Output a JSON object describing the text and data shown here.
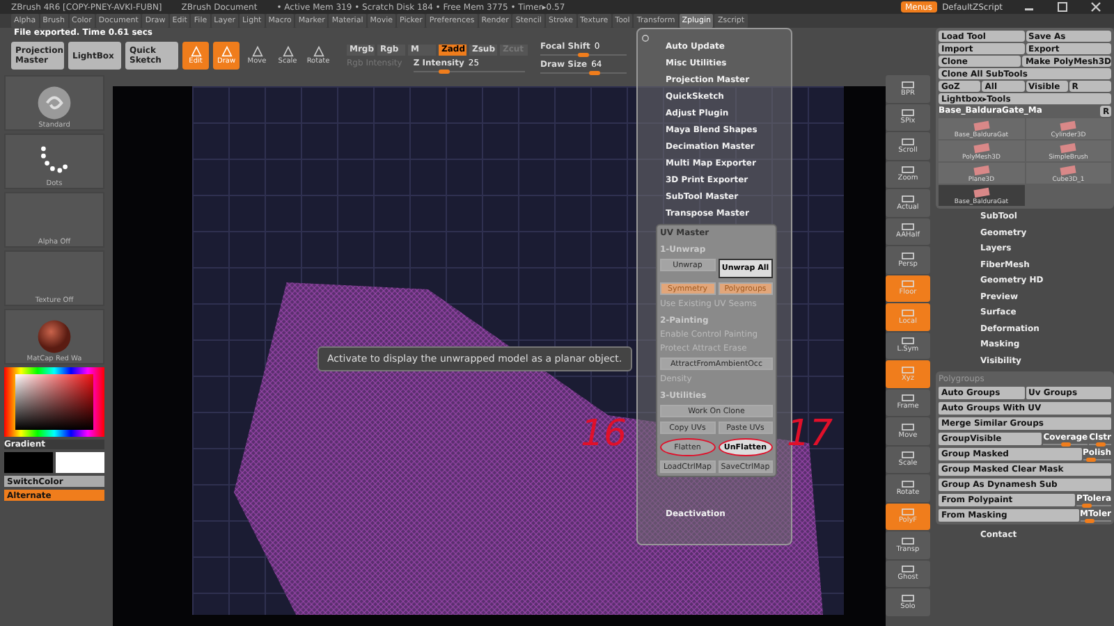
{
  "title_bar": {
    "app": "ZBrush 4R6 [COPY-PNEY-AVKI-FUBN]",
    "document": "ZBrush Document",
    "stats": "• Active Mem 319 • Scratch Disk 184 • Free Mem 3775 • Timer▸0.57",
    "menus_button": "Menus",
    "script": "DefaultZScript"
  },
  "menu_bar": [
    {
      "label": "Alpha",
      "selected": false
    },
    {
      "label": "Brush",
      "selected": false
    },
    {
      "label": "Color",
      "selected": false
    },
    {
      "label": "Document",
      "selected": false
    },
    {
      "label": "Draw",
      "selected": false
    },
    {
      "label": "Edit",
      "selected": false
    },
    {
      "label": "File",
      "selected": false
    },
    {
      "label": "Layer",
      "selected": false
    },
    {
      "label": "Light",
      "selected": false
    },
    {
      "label": "Macro",
      "selected": false
    },
    {
      "label": "Marker",
      "selected": false
    },
    {
      "label": "Material",
      "selected": false
    },
    {
      "label": "Movie",
      "selected": false
    },
    {
      "label": "Picker",
      "selected": false
    },
    {
      "label": "Preferences",
      "selected": false
    },
    {
      "label": "Render",
      "selected": false
    },
    {
      "label": "Stencil",
      "selected": false
    },
    {
      "label": "Stroke",
      "selected": false
    },
    {
      "label": "Texture",
      "selected": false
    },
    {
      "label": "Tool",
      "selected": false
    },
    {
      "label": "Transform",
      "selected": false
    },
    {
      "label": "Zplugin",
      "selected": true
    },
    {
      "label": "Zscript",
      "selected": false
    }
  ],
  "status": "File exported. Time 0.61 secs",
  "toolbar": {
    "buttons": [
      {
        "label": "Projection Master",
        "kind": "large",
        "on": false
      },
      {
        "label": "LightBox",
        "kind": "large",
        "on": false
      },
      {
        "label": "Quick Sketch",
        "kind": "large",
        "on": false
      },
      {
        "label": "Edit",
        "kind": "mode",
        "on": true
      },
      {
        "label": "Draw",
        "kind": "mode",
        "on": true
      },
      {
        "label": "Move",
        "kind": "mode",
        "on": false
      },
      {
        "label": "Scale",
        "kind": "mode",
        "on": false
      },
      {
        "label": "Rotate",
        "kind": "mode",
        "on": false
      }
    ],
    "toggles": [
      {
        "label": "Mrgb",
        "on": false,
        "disabled": false
      },
      {
        "label": "Rgb",
        "on": false,
        "disabled": false
      },
      {
        "label": "M",
        "on": false,
        "disabled": false
      },
      {
        "label": "Zadd",
        "on": true,
        "disabled": false
      },
      {
        "label": "Zsub",
        "on": false,
        "disabled": false
      },
      {
        "label": "Zcut",
        "on": false,
        "disabled": true
      }
    ],
    "rgb_intensity": "Rgb Intensity",
    "sliders": [
      {
        "label": "Focal Shift",
        "reading": "0",
        "level": 0.5
      },
      {
        "label": "Z Intensity",
        "reading": "25",
        "level": 0.25
      },
      {
        "label": "Draw Size",
        "reading": "64",
        "level": 0.64
      }
    ]
  },
  "shelf": {
    "items": [
      {
        "label": "Standard",
        "kind": "brush"
      },
      {
        "label": "Dots",
        "kind": "stroke"
      },
      {
        "label": "Alpha Off",
        "kind": "empty"
      },
      {
        "label": "Texture Off",
        "kind": "empty"
      },
      {
        "label": "MatCap Red Wa",
        "kind": "material"
      }
    ],
    "gradient": "Gradient",
    "switch_color": "SwitchColor",
    "alternate": {
      "label": "Alternate",
      "on": true
    }
  },
  "canvas": {
    "tooltip": "Activate to display the unwrapped model as a planar object.",
    "annotations": [
      "16",
      "17"
    ]
  },
  "zplugin_menu": {
    "items": [
      "Auto Update",
      "Misc Utilities",
      "Projection Master",
      "QuickSketch",
      "Adjust Plugin",
      "Maya Blend Shapes",
      "Decimation Master",
      "Multi Map Exporter",
      "3D Print Exporter",
      "SubTool Master",
      "Transpose Master"
    ],
    "uv_master": {
      "title": "UV Master",
      "rows": [
        {
          "kind": "heading",
          "label": "1-Unwrap"
        },
        {
          "kind": "buttons",
          "items": [
            {
              "label": "Unwrap",
              "kind": "dim",
              "circled": false
            },
            {
              "label": "Unwrap All",
              "kind": "active",
              "circled": false
            }
          ]
        },
        {
          "kind": "buttons",
          "items": [
            {
              "label": "Symmetry",
              "kind": "toggle_on",
              "circled": false
            },
            {
              "label": "Polygroups",
              "kind": "toggle_on",
              "circled": false
            }
          ]
        },
        {
          "kind": "text",
          "label": "Use Existing UV Seams"
        },
        {
          "kind": "heading",
          "label": "2-Painting"
        },
        {
          "kind": "text",
          "label": "Enable Control Painting"
        },
        {
          "kind": "text",
          "label": "Protect Attract Erase"
        },
        {
          "kind": "buttons",
          "items": [
            {
              "label": "AttractFromAmbientOcc",
              "kind": "dim",
              "circled": false
            }
          ]
        },
        {
          "kind": "text",
          "label": "Density"
        },
        {
          "kind": "heading",
          "label": "3-Utilities"
        },
        {
          "kind": "buttons",
          "items": [
            {
              "label": "Work On Clone",
              "kind": "dim",
              "circled": false
            }
          ]
        },
        {
          "kind": "buttons",
          "items": [
            {
              "label": "Copy UVs",
              "kind": "dim",
              "circled": false
            },
            {
              "label": "Paste UVs",
              "kind": "dim",
              "circled": false
            }
          ]
        },
        {
          "kind": "buttons",
          "items": [
            {
              "label": "Flatten",
              "kind": "dim",
              "circled": true
            },
            {
              "label": "UnFlatten",
              "kind": "active",
              "circled": true
            }
          ]
        },
        {
          "kind": "buttons",
          "items": [
            {
              "label": "LoadCtrlMap",
              "kind": "dim",
              "circled": false
            },
            {
              "label": "SaveCtrlMap",
              "kind": "dim",
              "circled": false
            }
          ]
        }
      ]
    },
    "deactivation": "Deactivation"
  },
  "view_strip": [
    {
      "label": "BPR",
      "on": false
    },
    {
      "label": "SPix",
      "on": false
    },
    {
      "label": "Scroll",
      "on": false
    },
    {
      "label": "Zoom",
      "on": false
    },
    {
      "label": "Actual",
      "on": false
    },
    {
      "label": "AAHalf",
      "on": false
    },
    {
      "label": "Persp",
      "on": false
    },
    {
      "label": "Floor",
      "on": true
    },
    {
      "label": "Local",
      "on": true
    },
    {
      "label": "L.Sym",
      "on": false
    },
    {
      "label": "Xyz",
      "on": true
    },
    {
      "label": "Frame",
      "on": false
    },
    {
      "label": "Move",
      "on": false
    },
    {
      "label": "Scale",
      "on": false
    },
    {
      "label": "Rotate",
      "on": false
    },
    {
      "label": "PolyF",
      "on": true
    },
    {
      "label": "Transp",
      "on": false
    },
    {
      "label": "Ghost",
      "on": false
    },
    {
      "label": "Solo",
      "on": false
    }
  ],
  "tool_panel": {
    "button_rows": [
      [
        "Load Tool",
        "Save As"
      ],
      [
        "Import",
        "Export"
      ],
      [
        "Clone",
        "Make PolyMesh3D"
      ],
      [
        "Clone All SubTools"
      ],
      [
        "GoZ",
        "All",
        "Visible",
        "R"
      ],
      [
        "Lightbox▸Tools"
      ]
    ],
    "current_tool": "Base_BalduraGate_Ma",
    "current_r": "R",
    "thumbnails": [
      {
        "label": "Base_BalduraGat",
        "selected": false
      },
      {
        "label": "Cylinder3D",
        "selected": false
      },
      {
        "label": "PolyMesh3D",
        "selected": false
      },
      {
        "label": "SimpleBrush",
        "selected": false
      },
      {
        "label": "Plane3D",
        "selected": false
      },
      {
        "label": "Cube3D_1",
        "selected": false
      },
      {
        "label": "Base_BalduraGat",
        "selected": true
      }
    ],
    "sections": [
      "SubTool",
      "Geometry",
      "Layers",
      "FiberMesh",
      "Geometry HD",
      "Preview",
      "Surface",
      "Deformation",
      "Masking",
      "Visibility"
    ],
    "polygroups": {
      "title": "Polygroups",
      "rows": [
        [
          {
            "label": "Auto Groups",
            "kind": "button"
          },
          {
            "label": "Uv Groups",
            "kind": "button"
          }
        ],
        [
          {
            "label": "Auto Groups With UV",
            "kind": "button"
          }
        ],
        [
          {
            "label": "Merge Similar Groups",
            "kind": "button"
          }
        ],
        [
          {
            "label": "GroupVisible",
            "kind": "button"
          },
          {
            "label": "Coverage",
            "kind": "slider",
            "level": 0.5
          },
          {
            "label": "Clstr",
            "kind": "slider",
            "level": 0.5
          }
        ],
        [
          {
            "label": "Group Masked",
            "kind": "button"
          },
          {
            "label": "Polish",
            "kind": "slider",
            "level": 0.2
          }
        ],
        [
          {
            "label": "Group Masked Clear Mask",
            "kind": "button"
          }
        ],
        [
          {
            "label": "Group As Dynamesh Sub",
            "kind": "button"
          }
        ],
        [
          {
            "label": "From Polypaint",
            "kind": "button"
          },
          {
            "label": "PTolera",
            "kind": "slider",
            "level": 0.2
          }
        ],
        [
          {
            "label": "From Masking",
            "kind": "button"
          },
          {
            "label": "MToler",
            "kind": "slider",
            "level": 0.2
          }
        ]
      ]
    },
    "footer": "Contact"
  }
}
